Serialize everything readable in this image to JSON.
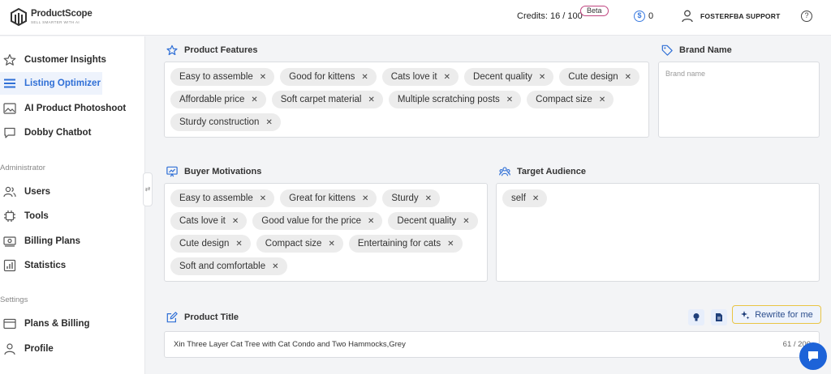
{
  "brand": {
    "name": "ProductScope",
    "tagline": "SELL SMARTER WITH AI"
  },
  "header": {
    "credits_label": "Credits: 16 / 100",
    "beta_label": "Beta",
    "balance": "0",
    "user_name": "FOSTERFBA SUPPORT"
  },
  "sidebar": {
    "main_items": [
      {
        "label": "Customer Insights",
        "icon": "star-icon"
      },
      {
        "label": "Listing Optimizer",
        "icon": "list-icon",
        "active": true
      },
      {
        "label": "AI Product Photoshoot",
        "icon": "image-icon"
      },
      {
        "label": "Dobby Chatbot",
        "icon": "chat-icon"
      }
    ],
    "admin_label": "Administrator",
    "admin_items": [
      {
        "label": "Users",
        "icon": "users-icon"
      },
      {
        "label": "Tools",
        "icon": "chip-icon"
      },
      {
        "label": "Billing Plans",
        "icon": "billing-icon"
      },
      {
        "label": "Statistics",
        "icon": "chart-icon"
      }
    ],
    "settings_label": "Settings",
    "settings_items": [
      {
        "label": "Plans & Billing",
        "icon": "wallet-icon"
      },
      {
        "label": "Profile",
        "icon": "profile-icon"
      }
    ]
  },
  "product_features": {
    "title": "Product Features",
    "chips": [
      "Easy to assemble",
      "Good for kittens",
      "Cats love it",
      "Decent quality",
      "Cute design",
      "Affordable price",
      "Soft carpet material",
      "Multiple scratching posts",
      "Compact size",
      "Sturdy construction"
    ]
  },
  "brand_name": {
    "title": "Brand Name",
    "placeholder": "Brand name"
  },
  "buyer_motivations": {
    "title": "Buyer Motivations",
    "chips": [
      "Easy to assemble",
      "Great for kittens",
      "Sturdy",
      "Cats love it",
      "Good value for the price",
      "Decent quality",
      "Cute design",
      "Compact size",
      "Entertaining for cats",
      "Soft and comfortable"
    ]
  },
  "target_audience": {
    "title": "Target Audience",
    "chips": [
      "self"
    ]
  },
  "product_title": {
    "title": "Product Title",
    "rewrite_label": "Rewrite for me",
    "value": "Xin Three Layer Cat Tree with Cat Condo and Two Hammocks,Grey",
    "count": "61 / 200"
  },
  "chip_remove_glyph": "✕"
}
